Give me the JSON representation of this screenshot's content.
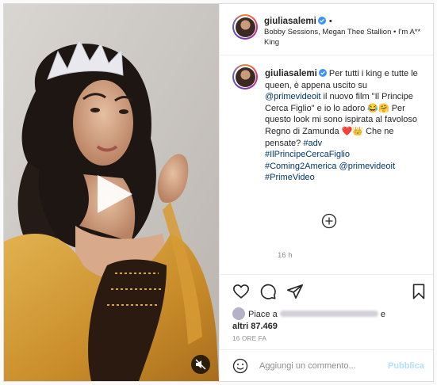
{
  "post": {
    "username": "giuliasalemi",
    "header_dot": "•",
    "music": "Bobby Sessions, Megan Thee Stallion • I'm A** King",
    "caption": {
      "username": "giuliasalemi",
      "text_1": "Per tutti i king e tutte le queen, è appena uscito su ",
      "mention_1": "@primevideoit",
      "text_2": " il nuovo film \"Il Principe Cerca Figlio\" e io lo adoro 😂🤗 Per questo look mi sono ispirata al favoloso Regno di Zamunda ❤️👑 Che ne pensate? ",
      "tag_adv": "#adv",
      "tag_film": "#IlPrincipeCercaFiglio",
      "tag_coming": "#Coming2America",
      "mention_2": "@primevideoit",
      "tag_prime": "#PrimeVideo",
      "time": "16 h"
    },
    "likes": {
      "prefix": "Piace a",
      "and": "e",
      "others": "altri 87.469"
    },
    "date": "16 ORE FA",
    "comment": {
      "placeholder": "Aggiungi un commento...",
      "publish_label": "Pubblica"
    }
  }
}
